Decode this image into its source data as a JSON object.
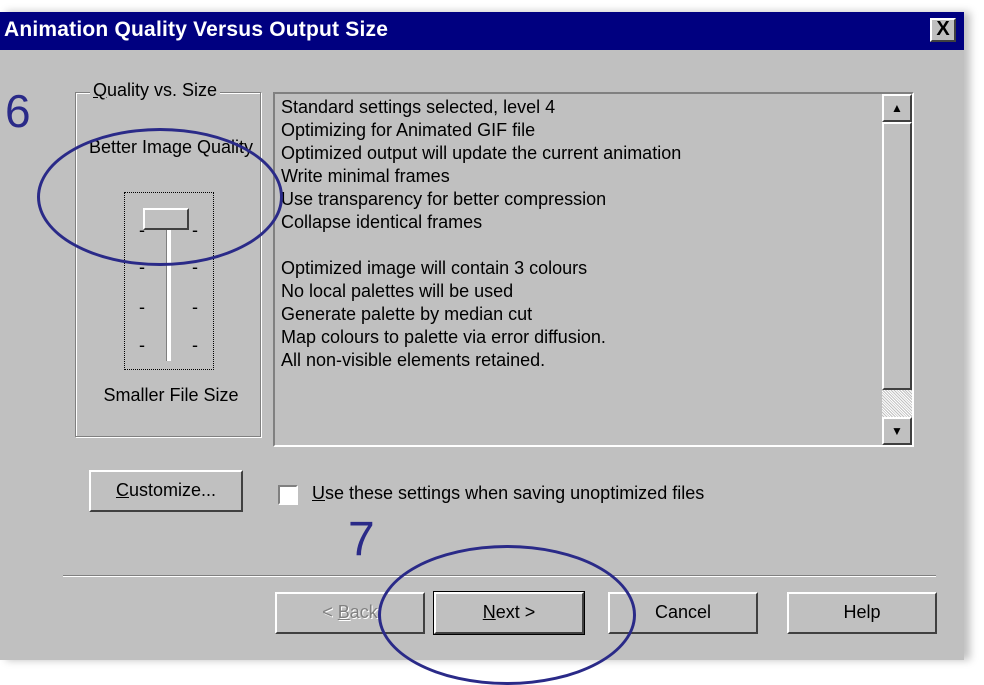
{
  "window": {
    "title": "Animation Quality Versus Output Size",
    "close_label": "X"
  },
  "group": {
    "label_accel": "Q",
    "label_rest": "uality vs. Size",
    "top_label": "Better Image Quality",
    "bottom_label": "Smaller File Size",
    "slider_level": 4,
    "slider_levels_total": 4
  },
  "details": {
    "lines": [
      "Standard settings selected, level 4",
      "Optimizing for Animated GIF file",
      "Optimized output will update the current animation",
      "Write minimal frames",
      "Use transparency for better compression",
      "Collapse identical frames",
      "",
      "Optimized image will contain 3 colours",
      "No local palettes will be used",
      "Generate palette by median cut",
      "Map colours to palette via error diffusion.",
      "All non-visible elements retained."
    ],
    "scroll_up_icon": "up-arrow",
    "scroll_down_icon": "down-arrow"
  },
  "customize": {
    "accel": "C",
    "rest": "ustomize..."
  },
  "use_settings": {
    "checked": false,
    "accel": "U",
    "rest": "se these settings when saving unoptimized files"
  },
  "footer": {
    "back_prefix": "< ",
    "back_accel": "B",
    "back_rest": "ack",
    "next_accel": "N",
    "next_rest": "ext >",
    "cancel": "Cancel",
    "help": "Help"
  },
  "annotations": {
    "step_a": "6",
    "step_b": "7",
    "color": "#2a2a88"
  }
}
